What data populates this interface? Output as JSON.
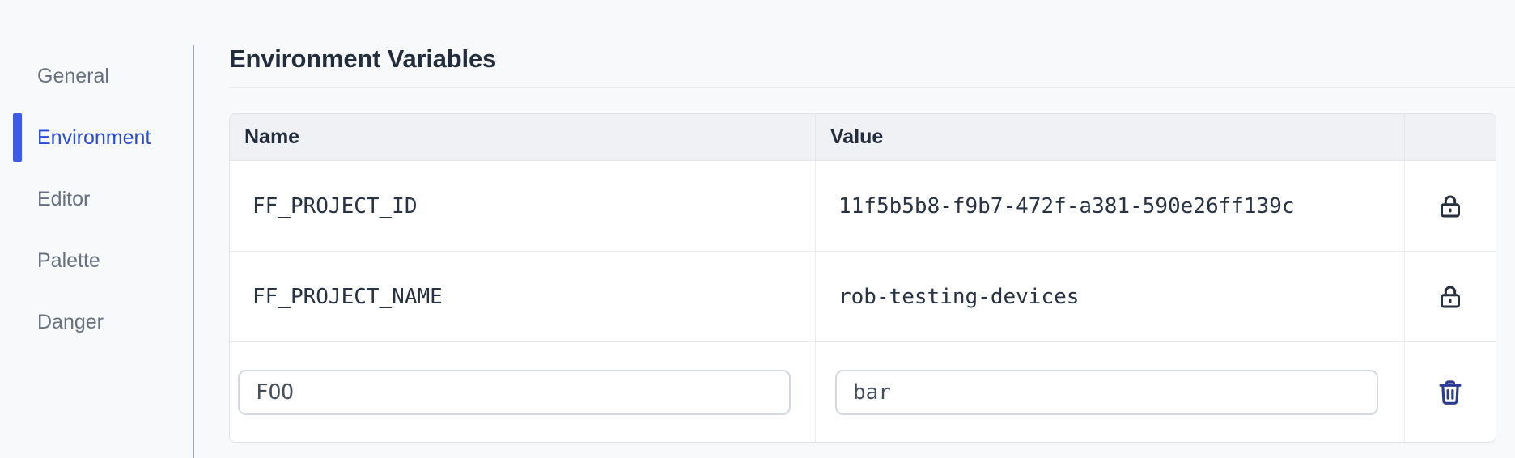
{
  "sidebar": {
    "items": [
      {
        "label": "General",
        "active": false
      },
      {
        "label": "Environment",
        "active": true
      },
      {
        "label": "Editor",
        "active": false
      },
      {
        "label": "Palette",
        "active": false
      },
      {
        "label": "Danger",
        "active": false
      }
    ]
  },
  "page": {
    "title": "Environment Variables"
  },
  "table": {
    "columns": {
      "name": "Name",
      "value": "Value",
      "actions": ""
    },
    "rows": [
      {
        "name": "FF_PROJECT_ID",
        "value": "11f5b5b8-f9b7-472f-a381-590e26ff139c",
        "locked": true
      },
      {
        "name": "FF_PROJECT_NAME",
        "value": "rob-testing-devices",
        "locked": true
      }
    ],
    "editable_row": {
      "name_value": "FOO",
      "value_value": "bar"
    }
  },
  "icons": {
    "lock": "lock-icon",
    "trash": "trash-icon"
  },
  "colors": {
    "accent_blue": "#2c4bd4",
    "indicator_blue": "#3d5be4",
    "trash_navy": "#2b3b94",
    "lock_slate": "#27303f",
    "page_background": "#f8f9fb",
    "table_header_fill": "#f0f1f4",
    "border_gray": "#e4e6eb"
  }
}
